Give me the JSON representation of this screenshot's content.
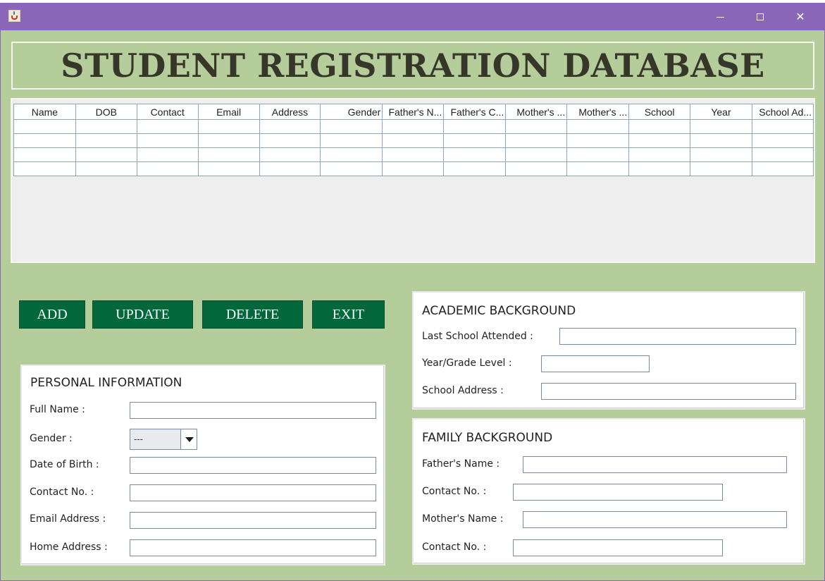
{
  "window": {
    "minimize_glyph": "—",
    "close_glyph": "✕"
  },
  "header": {
    "title": "STUDENT REGISTRATION DATABASE"
  },
  "table": {
    "columns": [
      "Name",
      "DOB",
      "Contact",
      "Email",
      "Address",
      "Gender",
      "Father's N...",
      "Father's C...",
      "Mother's ...",
      "Mother's ...",
      "School",
      "Year",
      "School Ad..."
    ],
    "rows": [
      [
        "",
        "",
        "",
        "",
        "",
        "",
        "",
        "",
        "",
        "",
        "",
        "",
        ""
      ],
      [
        "",
        "",
        "",
        "",
        "",
        "",
        "",
        "",
        "",
        "",
        "",
        "",
        ""
      ],
      [
        "",
        "",
        "",
        "",
        "",
        "",
        "",
        "",
        "",
        "",
        "",
        "",
        ""
      ],
      [
        "",
        "",
        "",
        "",
        "",
        "",
        "",
        "",
        "",
        "",
        "",
        "",
        ""
      ]
    ]
  },
  "buttons": {
    "add": "ADD",
    "update": "UPDATE",
    "delete": "DELETE",
    "exit": "EXIT"
  },
  "personal": {
    "title": "PERSONAL INFORMATION",
    "full_name_label": "Full Name :",
    "full_name_value": "",
    "gender_label": "Gender :",
    "gender_value": "---",
    "dob_label": "Date of Birth :",
    "dob_value": "",
    "contact_label": "Contact No. :",
    "contact_value": "",
    "email_label": "Email Address :",
    "email_value": "",
    "home_label": "Home Address :",
    "home_value": ""
  },
  "academic": {
    "title": "ACADEMIC BACKGROUND",
    "school_label": "Last School Attended :",
    "school_value": "",
    "year_label": "Year/Grade Level :",
    "year_value": "",
    "address_label": "School Address :",
    "address_value": ""
  },
  "family": {
    "title": "FAMILY BACKGROUND",
    "father_label": "Father's Name :",
    "father_value": "",
    "father_contact_label": "Contact No. :",
    "father_contact_value": "",
    "mother_label": "Mother's Name :",
    "mother_value": "",
    "mother_contact_label": "Contact No. :",
    "mother_contact_value": ""
  },
  "colors": {
    "titlebar": "#8a66b8",
    "background": "#b5cc9b",
    "button": "#02673b",
    "title_text": "#363629"
  }
}
